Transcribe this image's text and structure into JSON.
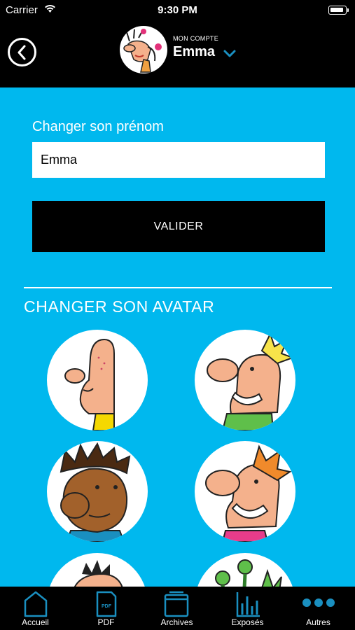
{
  "status_bar": {
    "carrier": "Carrier",
    "time": "9:30 PM"
  },
  "header": {
    "caption": "MON COMPTE",
    "user_name": "Emma"
  },
  "name_form": {
    "label": "Changer son prénom",
    "value": "Emma",
    "validate_label": "VALIDER"
  },
  "avatar_section": {
    "title": "CHANGER SON AVATAR"
  },
  "colors": {
    "background": "#00b8ee",
    "bars": "#000000",
    "accent": "#1a8fc0"
  },
  "tabs": [
    {
      "label": "Accueil",
      "icon": "home-icon"
    },
    {
      "label": "PDF",
      "icon": "pdf-icon",
      "badge": "PDF"
    },
    {
      "label": "Archives",
      "icon": "archives-icon"
    },
    {
      "label": "Exposés",
      "icon": "chart-icon"
    },
    {
      "label": "Autres",
      "icon": "more-icon"
    }
  ]
}
